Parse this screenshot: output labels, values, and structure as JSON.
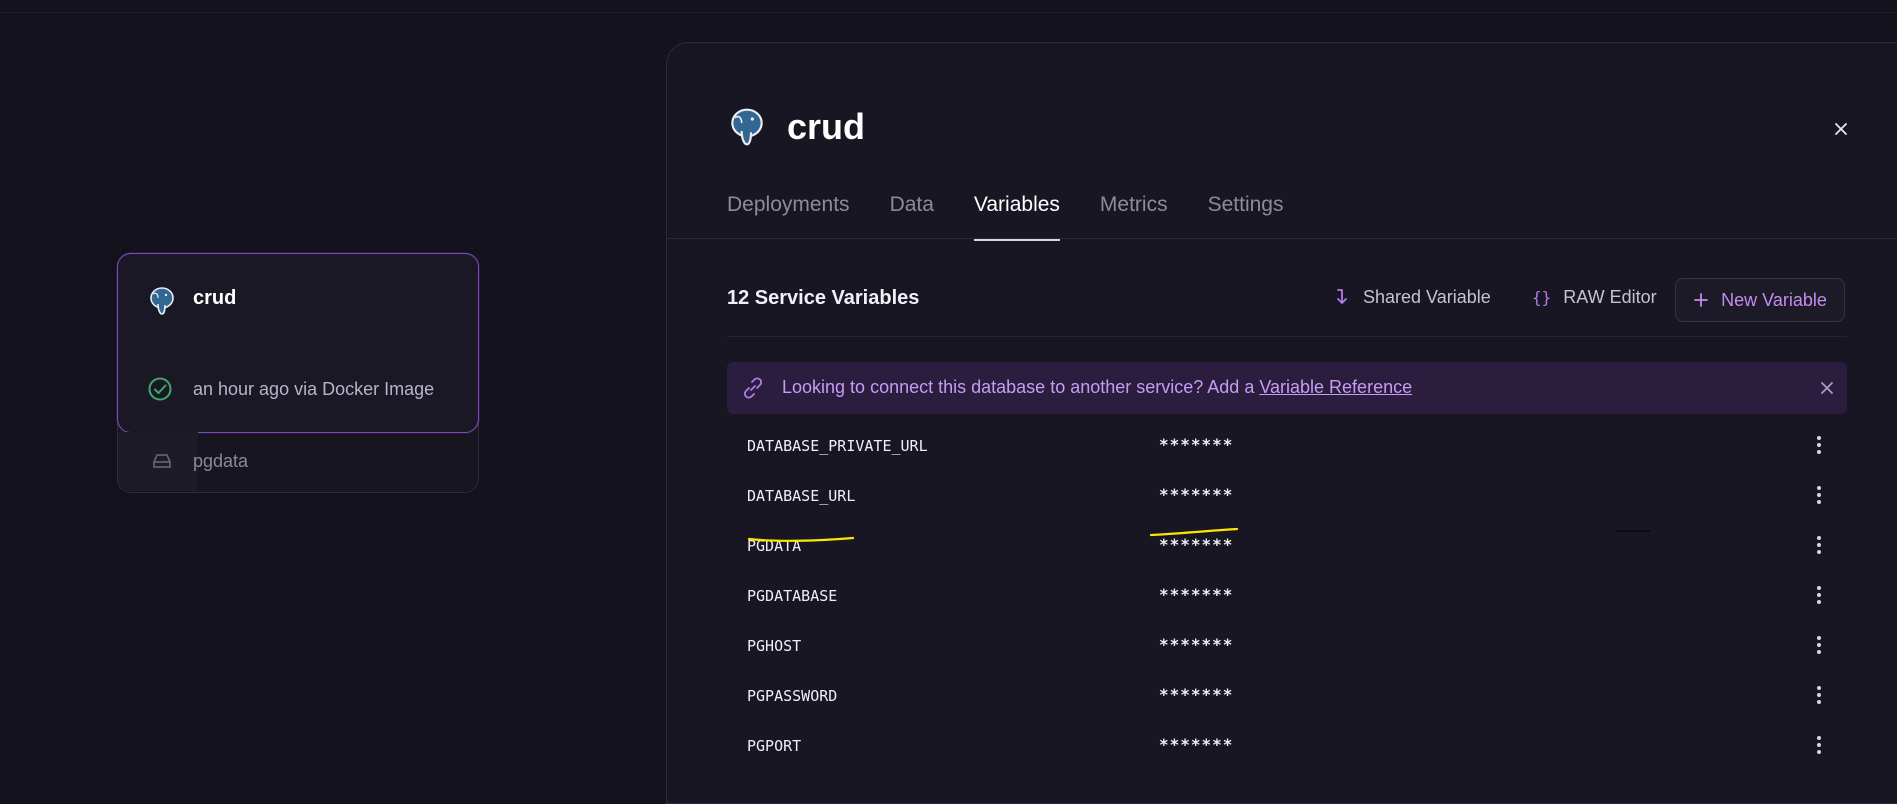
{
  "canvas": {
    "service_card": {
      "name": "crud",
      "status": "an hour ago via Docker Image",
      "volume": "pgdata"
    }
  },
  "panel": {
    "title": "crud",
    "tabs": [
      {
        "label": "Deployments"
      },
      {
        "label": "Data"
      },
      {
        "label": "Variables",
        "active": true
      },
      {
        "label": "Metrics"
      },
      {
        "label": "Settings"
      }
    ],
    "variables": {
      "count_title": "12 Service Variables",
      "shared_label": "Shared Variable",
      "raw_label": "RAW Editor",
      "new_label": "New Variable",
      "banner": {
        "text": "Looking to connect this database to another service? Add a",
        "link": "Variable Reference"
      },
      "rows": [
        {
          "name": "DATABASE_PRIVATE_URL",
          "value": "*******"
        },
        {
          "name": "DATABASE_URL",
          "value": "*******"
        },
        {
          "name": "PGDATA",
          "value": "*******"
        },
        {
          "name": "PGDATABASE",
          "value": "*******"
        },
        {
          "name": "PGHOST",
          "value": "*******"
        },
        {
          "name": "PGPASSWORD",
          "value": "*******"
        },
        {
          "name": "PGPORT",
          "value": "*******"
        }
      ]
    }
  },
  "colors": {
    "background": "#13111c",
    "accent": "#7b4cc4",
    "banner_text": "#c79cf4",
    "success": "#3fa66d",
    "highlight": "#ffe600"
  }
}
